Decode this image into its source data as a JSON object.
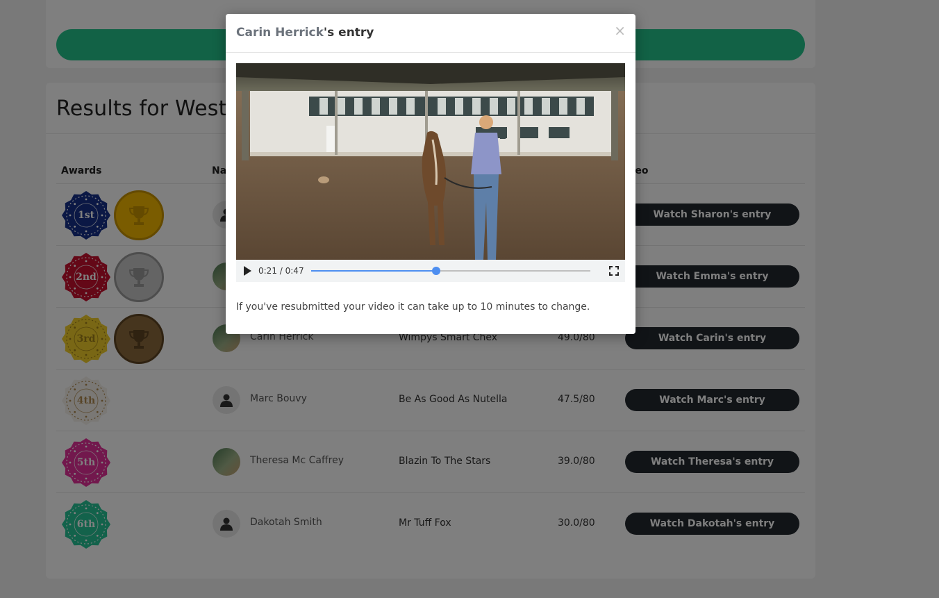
{
  "page": {
    "results_title": "Results for West",
    "columns": {
      "awards": "Awards",
      "name": "Name",
      "video": "Video"
    },
    "rows": [
      {
        "award": "1st",
        "award_colors": [
          "#16318a",
          "#ffffff"
        ],
        "trophy": "gold",
        "rider": "Sharon",
        "horse": "",
        "score": "",
        "watch_label": "Watch Sharon's entry",
        "avatar": "person-icon"
      },
      {
        "award": "2nd",
        "award_colors": [
          "#c8102e",
          "#ffffff"
        ],
        "trophy": "silver",
        "rider": "Emma",
        "horse": "",
        "score": "",
        "watch_label": "Watch Emma's entry",
        "avatar": "photo"
      },
      {
        "award": "3rd",
        "award_colors": [
          "#f2cf2a",
          "#a08018"
        ],
        "trophy": "bronze",
        "rider": "Carin Herrick",
        "horse": "Wimpys Smart Chex",
        "score": "49.0/80",
        "watch_label": "Watch Carin's entry",
        "avatar": "photo"
      },
      {
        "award": "4th",
        "award_colors": [
          "#f4f1ea",
          "#b08a50"
        ],
        "trophy": "",
        "rider": "Marc Bouvy",
        "horse": "Be As Good As Nutella",
        "score": "47.5/80",
        "watch_label": "Watch Marc's entry",
        "avatar": "person-icon"
      },
      {
        "award": "5th",
        "award_colors": [
          "#e5309a",
          "#ffffff"
        ],
        "trophy": "",
        "rider": "Theresa Mc Caffrey",
        "horse": "Blazin To The Stars",
        "score": "39.0/80",
        "watch_label": "Watch Theresa's entry",
        "avatar": "photo"
      },
      {
        "award": "6th",
        "award_colors": [
          "#27c497",
          "#ffffff"
        ],
        "trophy": "",
        "rider": "Dakotah Smith",
        "horse": "Mr Tuff Fox",
        "score": "30.0/80",
        "watch_label": "Watch Dakotah's entry",
        "avatar": "person-icon"
      }
    ]
  },
  "modal": {
    "title_name": "Carin Herrick",
    "title_suffix": "'s entry",
    "close_glyph": "×",
    "video": {
      "time_current": "0:21",
      "time_separator": " / ",
      "time_total": "0:47",
      "progress": 0.447
    },
    "note": "If you've resubmitted your video it can take up to 10 minutes to change."
  },
  "colors": {
    "accent_green": "#24c48c",
    "button_dark": "#23282f",
    "progress_blue": "#4d8ef0"
  }
}
